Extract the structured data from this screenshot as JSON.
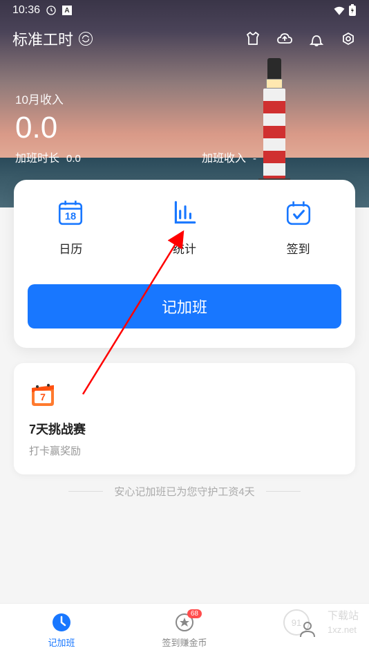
{
  "status_bar": {
    "time": "10:36"
  },
  "header": {
    "title": "标准工时",
    "icons": [
      "shirt-icon",
      "cloud-upload-icon",
      "bell-icon",
      "settings-icon"
    ]
  },
  "income": {
    "label": "10月收入",
    "value": "0.0"
  },
  "overtime": {
    "hours_label": "加班时长",
    "hours_value": "0.0",
    "income_label": "加班收入",
    "income_value": "-"
  },
  "nav": {
    "calendar": {
      "label": "日历",
      "day": "18"
    },
    "stats": {
      "label": "统计"
    },
    "checkin": {
      "label": "签到"
    }
  },
  "record_button": "记加班",
  "challenge": {
    "day": "7",
    "title": "7天挑战赛",
    "subtitle": "打卡赢奖励"
  },
  "guard_message": "安心记加班已为您守护工资4天",
  "bottom_nav": {
    "record": {
      "label": "记加班"
    },
    "coins": {
      "label": "签到赚金币",
      "badge": "68"
    },
    "mine": {
      "label": ""
    }
  },
  "watermark": {
    "line1": "下载站",
    "line2": "1xz.net"
  }
}
